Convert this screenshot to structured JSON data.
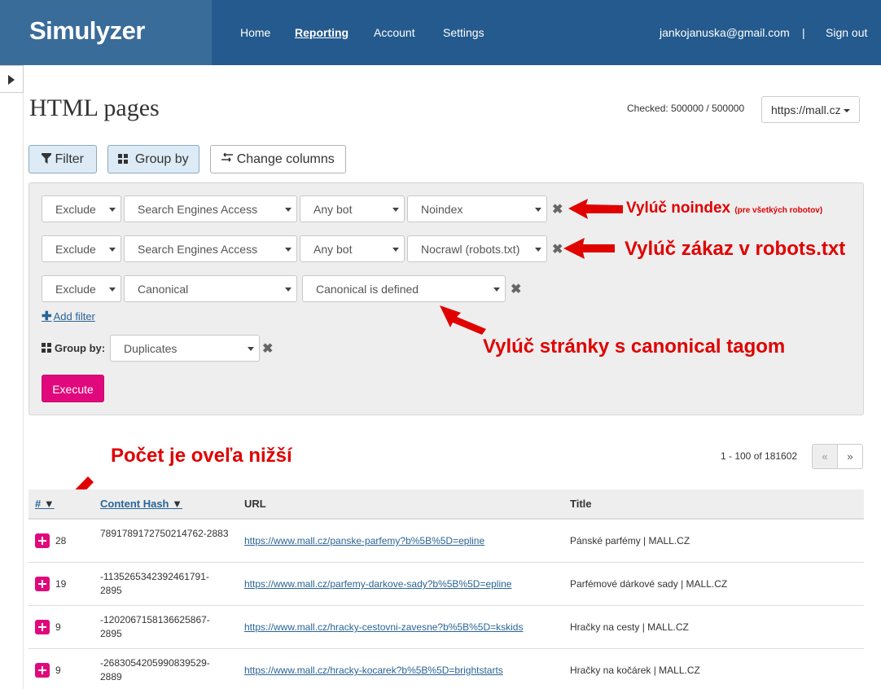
{
  "header": {
    "brand": "Simulyzer",
    "nav": [
      "Home",
      "Reporting",
      "Account",
      "Settings"
    ],
    "active": "Reporting",
    "user_email": "jankojanuska@gmail.com",
    "separator": "|",
    "sign_out": "Sign out",
    "bg_color": "#245a8d"
  },
  "page": {
    "title": "HTML pages",
    "checked_label": "Checked: 500000 / 500000",
    "site_select": "https://mall.cz"
  },
  "toolbar": {
    "filter": "Filter",
    "group_by": "Group by",
    "change_columns": "Change columns"
  },
  "filters": [
    {
      "mode": "Exclude",
      "field": "Search Engines Access",
      "bot": "Any bot",
      "value": "Noindex"
    },
    {
      "mode": "Exclude",
      "field": "Search Engines Access",
      "bot": "Any bot",
      "value": "Nocrawl (robots.txt)"
    },
    {
      "mode": "Exclude",
      "field": "Canonical",
      "value": "Canonical is defined"
    }
  ],
  "add_filter": "Add filter",
  "group_by": {
    "label": "Group by:",
    "value": "Duplicates"
  },
  "execute": "Execute",
  "annotations": {
    "noindex": "Vylúč noindex",
    "noindex_small": "(pre všetkých robotov)",
    "robots": "Vylúč zákaz v robots.txt",
    "canonical": "Vylúč stránky s canonical tagom",
    "count": "Počet je oveľa nižší",
    "color": "#e00000"
  },
  "pagination": {
    "info": "1 - 100 of 181602",
    "prev": "«",
    "next": "»"
  },
  "table": {
    "headers": {
      "count": "#",
      "count_sort": "▼",
      "hash": "Content Hash",
      "hash_sort": "▼",
      "url": "URL",
      "title": "Title"
    },
    "rows": [
      {
        "count": "28",
        "hash": "7891789172750214762-2883",
        "url": "https://www.mall.cz/panske-parfemy?b%5B%5D=epline",
        "title": "Pánské parfémy | MALL.CZ"
      },
      {
        "count": "19",
        "hash": "-1135265342392461791-2895",
        "url": "https://www.mall.cz/parfemy-darkove-sady?b%5B%5D=epline",
        "title": "Parfémové dárkové sady | MALL.CZ"
      },
      {
        "count": "9",
        "hash": "-1202067158136625867-2895",
        "url": "https://www.mall.cz/hracky-cestovni-zavesne?b%5B%5D=kskids",
        "title": "Hračky na cesty | MALL.CZ"
      },
      {
        "count": "9",
        "hash": "-2683054205990839529-2889",
        "url": "https://www.mall.cz/hracky-kocarek?b%5B%5D=brightstarts",
        "title": "Hračky na kočárek | MALL.CZ"
      }
    ]
  }
}
